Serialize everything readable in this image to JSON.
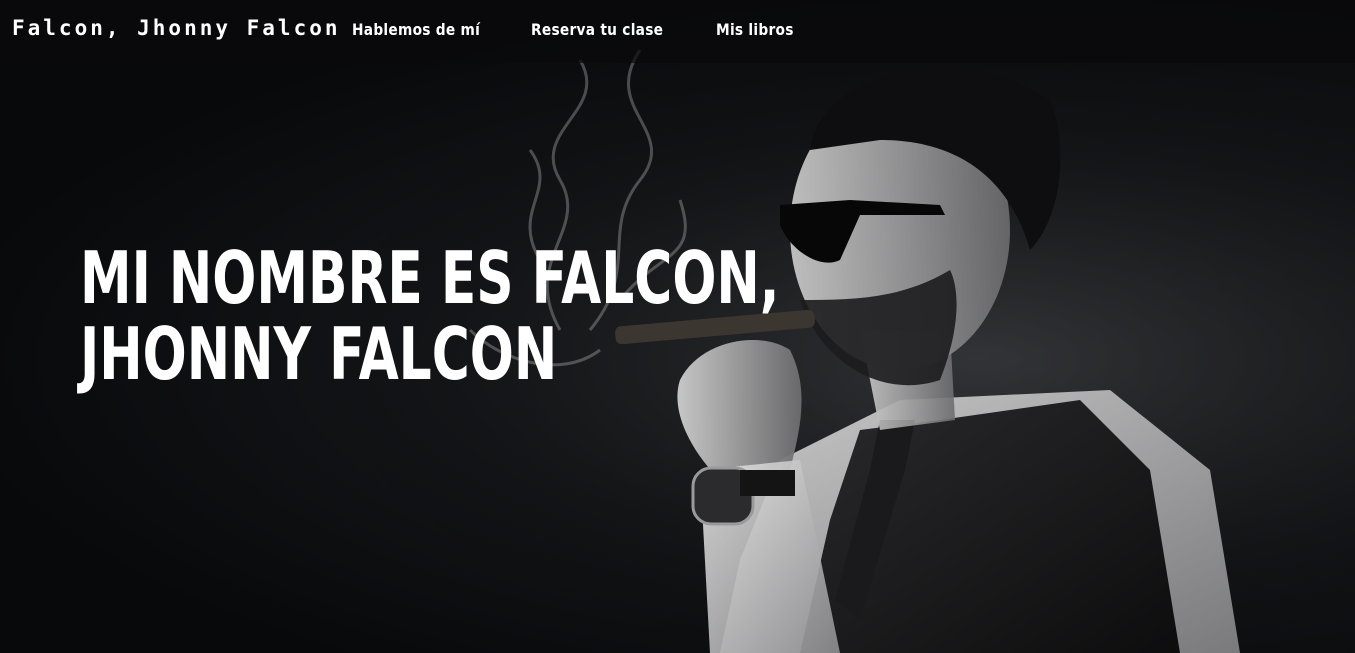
{
  "header": {
    "brand": "Falcon, Jhonny Falcon",
    "nav": [
      {
        "label": "Hablemos de mí"
      },
      {
        "label": "Reserva tu clase"
      },
      {
        "label": "Mis libros"
      }
    ]
  },
  "hero": {
    "title_line1": "MI NOMBRE ES FALCON,",
    "title_line2": "JHONNY FALCON",
    "image": "man-smoking-cigar-photo"
  },
  "colors": {
    "background": "#0a0b0d",
    "text": "#ffffff"
  }
}
